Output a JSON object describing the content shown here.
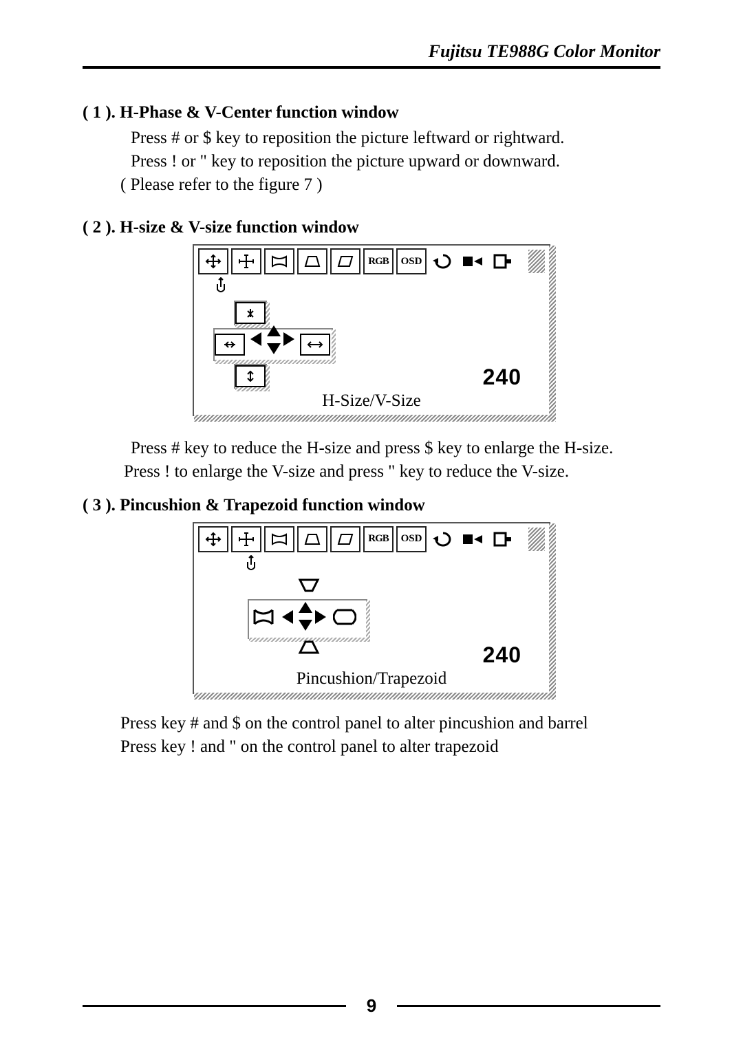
{
  "header": {
    "title": "Fujitsu TE988G Color Monitor"
  },
  "s1": {
    "head": "( 1 ). H-Phase & V-Center function window",
    "l1": "Press #  or $  key to reposition the picture leftward or rightward.",
    "l2": "Press !  or \"  key to reposition the picture upward or downward.",
    "l3": "( Please refer to the figure 7 )"
  },
  "s2": {
    "head": "( 2 ). H-size & V-size function window",
    "l1": "Press #  key to reduce the H-size and press $  key to enlarge the H-size.",
    "l2": "Press !  to enlarge the V-size and press \"  key to reduce the V-size."
  },
  "s3": {
    "head": "( 3 ). Pincushion & Trapezoid function window",
    "l1": "Press key #  and $  on the control panel to alter pincushion and barrel",
    "l2": "Press key !  and \"  on the control panel to alter trapezoid"
  },
  "osd": {
    "tabs": {
      "rgb": "RGB",
      "osd": "OSD"
    },
    "readout": "240",
    "caption_a": "H-Size/V-Size",
    "caption_b": "Pincushion/Trapezoid"
  },
  "page_number": "9"
}
